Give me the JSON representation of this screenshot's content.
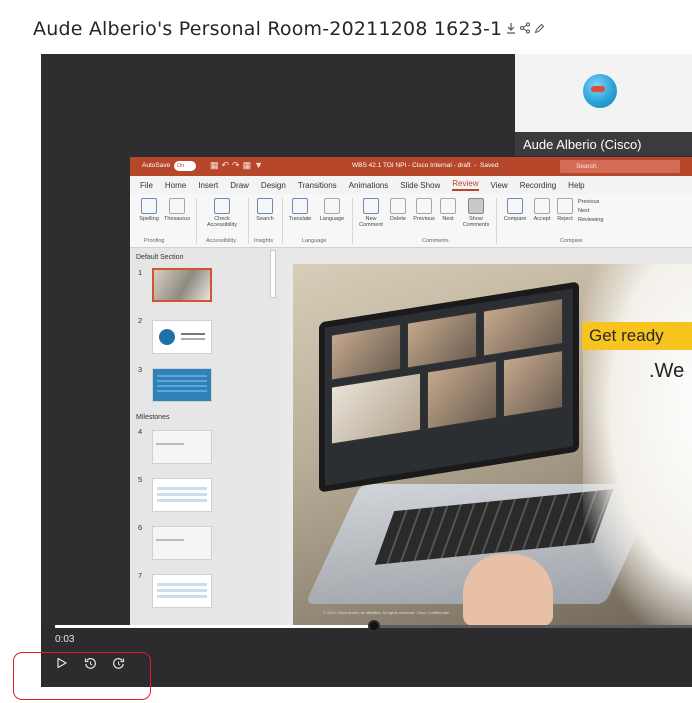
{
  "recording": {
    "title": "Aude Alberio's Personal Room-20211208 1623-1",
    "title_icons": [
      "download-icon",
      "share-icon",
      "edit-icon"
    ]
  },
  "participant": {
    "name": "Aude Alberio (Cisco)"
  },
  "powerpoint": {
    "titlebar": {
      "autosave_label": "AutoSave",
      "toggle_label": "On",
      "doc_title": "WBS 42.1 TOI NPI - Cisco Internal - draft",
      "saved": "Saved",
      "search_placeholder": "Search"
    },
    "menu": [
      "File",
      "Home",
      "Insert",
      "Draw",
      "Design",
      "Transitions",
      "Animations",
      "Slide Show",
      "Review",
      "View",
      "Recording",
      "Help"
    ],
    "active_menu": "Review",
    "ribbon": {
      "buttons": [
        "Spelling",
        "Thesaurus",
        "Check Accessibility",
        "Search",
        "Translate",
        "Language",
        "New Comment",
        "Delete",
        "Previous",
        "Next",
        "Show Comments",
        "Compare",
        "Accept",
        "Reject",
        "Previous",
        "Next",
        "Reviewing"
      ],
      "groups": [
        "Proofing",
        "Accessibility",
        "Insights",
        "Language",
        "Comments",
        "Compare"
      ]
    },
    "thumbnails": {
      "section_default": "Default Section",
      "section_milestones": "Milestones",
      "slide_numbers": [
        "1",
        "2",
        "3",
        "4",
        "5",
        "6",
        "7"
      ]
    },
    "slide": {
      "banner": "Get ready",
      "subtext": ".We",
      "copyright": "© 2021 Cisco and/or its affiliates. All rights reserved. Cisco Confidential"
    }
  },
  "player": {
    "current_time": "0:03",
    "progress": 0.5,
    "controls": [
      "play-icon",
      "rewind-icon",
      "forward-icon"
    ]
  },
  "colors": {
    "annotation_box": "#e8192c",
    "ppt_accent": "#b7472a",
    "banner": "#f7c31e"
  }
}
